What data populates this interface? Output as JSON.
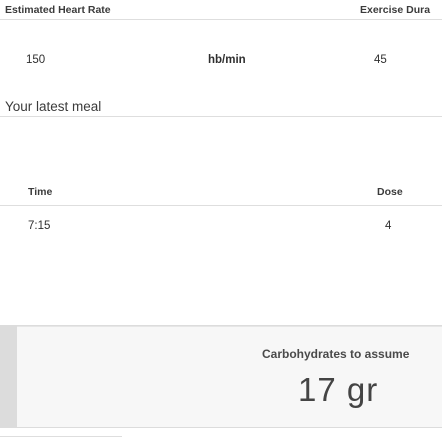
{
  "heart_rate": {
    "label": "Estimated Heart Rate",
    "value": "150",
    "unit": "hb/min"
  },
  "exercise": {
    "label": "Exercise Dura",
    "value": "45"
  },
  "meal": {
    "title": "Your latest meal",
    "time_label": "Time",
    "time_value": "7:15",
    "dose_label": "Dose",
    "dose_value": "4"
  },
  "carbs": {
    "label": "Carbohydrates to assume",
    "value": "17 gr"
  }
}
